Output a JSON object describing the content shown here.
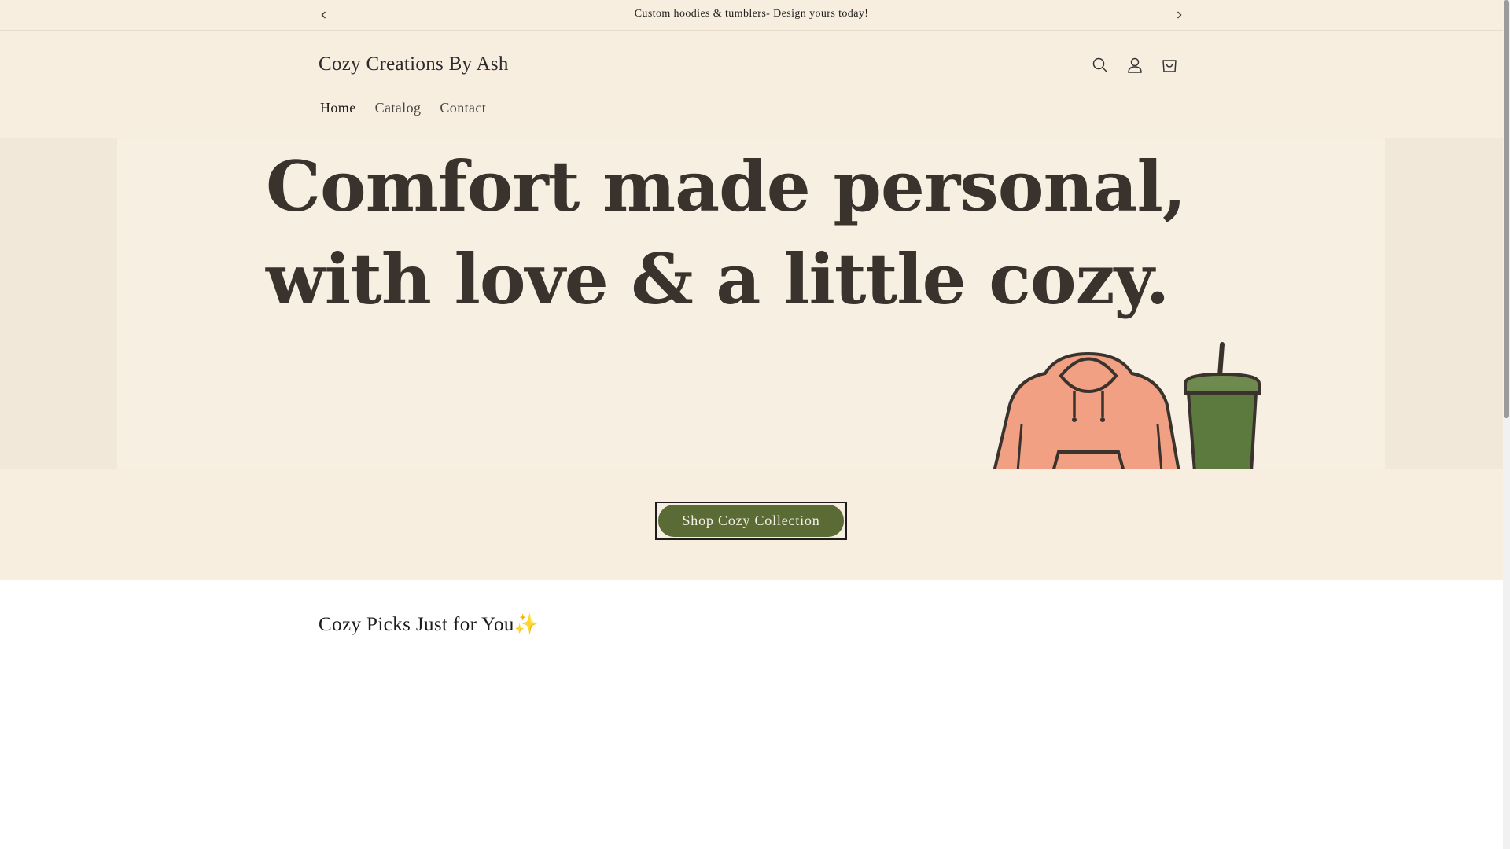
{
  "announcement": {
    "message": "Custom hoodies & tumblers- Design yours today!",
    "prev_icon": "chevron-left-icon",
    "next_icon": "chevron-right-icon"
  },
  "header": {
    "logo": "Cozy Creations By Ash",
    "icons": [
      "search-icon",
      "account-icon",
      "cart-icon"
    ],
    "nav": [
      {
        "label": "Home",
        "active": true
      },
      {
        "label": "Catalog",
        "active": false
      },
      {
        "label": "Contact",
        "active": false
      }
    ]
  },
  "hero": {
    "headline_line1": "Comfort made personal,",
    "headline_line2": "with love & a little cozy.",
    "colors": {
      "hoodie": "#f2a083",
      "tumbler": "#5d7a3e"
    }
  },
  "cta": {
    "label": "Shop Cozy Collection"
  },
  "featured": {
    "title": "Cozy Picks Just for You✨"
  },
  "colors": {
    "background_cream": "#f7eee0",
    "button_green": "#5a6b36"
  }
}
